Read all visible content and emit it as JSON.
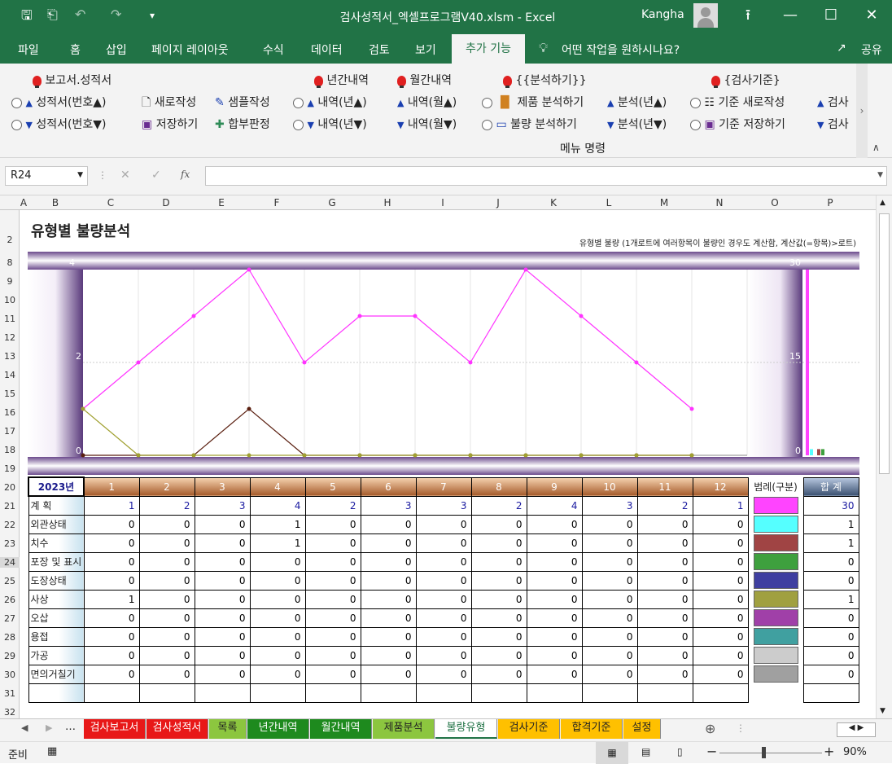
{
  "window": {
    "title": "검사성적서_엑셀프로그램V40.xlsm  -  Excel",
    "user": "Kangha"
  },
  "ribbon_tabs": [
    "파일",
    "홈",
    "삽입",
    "페이지 레이아웃",
    "수식",
    "데이터",
    "검토",
    "보기",
    "추가 기능"
  ],
  "active_tab": "추가 기능",
  "tell_me": "어떤 작업을 원하시나요?",
  "share": "공유",
  "ribbon": {
    "g1_title": "보고서.성적서",
    "g1a": "성적서(번호▲)",
    "g1b": "성적서(번호▼)",
    "g1c": "새로작성",
    "g1d": "저장하기",
    "g1e": "샘플작성",
    "g1f": "합부판정",
    "g2_title": "년간내역",
    "g2a": "내역(년▲)",
    "g2b": "내역(년▼)",
    "g3_title": "월간내역",
    "g3a": "내역(월▲)",
    "g3b": "내역(월▼)",
    "g4_title": "{{분석하기}}",
    "g4a": "제품 분석하기",
    "g4b": "불량 분석하기",
    "g4c": "분석(년▲)",
    "g4d": "분석(년▼)",
    "g5_title": "{검사기준}",
    "g5a": "기준 새로작성",
    "g5b": "기준 저장하기",
    "g5c": "검사",
    "g5d": "검사",
    "group_label": "메뉴 명령"
  },
  "namebox": "R24",
  "columns": [
    "A",
    "B",
    "C",
    "D",
    "E",
    "F",
    "G",
    "H",
    "I",
    "J",
    "K",
    "L",
    "M",
    "N",
    "O",
    "P"
  ],
  "rows": [
    "2",
    "8",
    "9",
    "10",
    "11",
    "12",
    "13",
    "14",
    "15",
    "16",
    "17",
    "18",
    "19",
    "20",
    "21",
    "22",
    "23",
    "24",
    "25",
    "26",
    "27",
    "28",
    "29",
    "30",
    "31",
    "32"
  ],
  "sheet": {
    "title": "유형별 불량분석",
    "note": "유형별 불량 (1개로트에 여러항목이 불량인 경우도 계산함, 계산값(=항목)>로트)",
    "year": "2023년",
    "legend_header": "범례(구분)",
    "total_header": "합 계"
  },
  "chart_data": {
    "type": "line",
    "x": [
      1,
      2,
      3,
      4,
      5,
      6,
      7,
      8,
      9,
      10,
      11,
      12
    ],
    "left_axis": {
      "ticks": [
        "4",
        "2",
        "0"
      ],
      "ylim": [
        0,
        4
      ]
    },
    "right_axis": {
      "ticks": [
        "30",
        "15",
        "0"
      ],
      "ylim": [
        0,
        30
      ]
    },
    "series": [
      {
        "name": "계 획",
        "color": "#ff33ff",
        "values": [
          1,
          2,
          3,
          4,
          2,
          3,
          3,
          2,
          4,
          3,
          2,
          1
        ]
      },
      {
        "name": "외관상태",
        "color": "#5a1f10",
        "values": [
          0,
          0,
          0,
          1,
          0,
          0,
          0,
          0,
          0,
          0,
          0,
          0
        ]
      },
      {
        "name": "치수",
        "color": "#a0a030",
        "values": [
          1,
          0,
          0,
          0,
          0,
          0,
          0,
          0,
          0,
          0,
          0,
          0
        ]
      }
    ],
    "totals_bar": [
      30,
      1,
      1,
      1
    ]
  },
  "table": {
    "months": [
      "1",
      "2",
      "3",
      "4",
      "5",
      "6",
      "7",
      "8",
      "9",
      "10",
      "11",
      "12"
    ],
    "rows": [
      {
        "label": "계 획",
        "values": [
          "1",
          "2",
          "3",
          "4",
          "2",
          "3",
          "3",
          "2",
          "4",
          "3",
          "2",
          "1"
        ],
        "total": "30",
        "color": "#ff44ff"
      },
      {
        "label": "외관상태",
        "values": [
          "0",
          "0",
          "0",
          "1",
          "0",
          "0",
          "0",
          "0",
          "0",
          "0",
          "0",
          "0"
        ],
        "total": "1",
        "color": "#55ffff"
      },
      {
        "label": "치수",
        "values": [
          "0",
          "0",
          "0",
          "1",
          "0",
          "0",
          "0",
          "0",
          "0",
          "0",
          "0",
          "0"
        ],
        "total": "1",
        "color": "#a04444"
      },
      {
        "label": "포장 및 표시",
        "values": [
          "0",
          "0",
          "0",
          "0",
          "0",
          "0",
          "0",
          "0",
          "0",
          "0",
          "0",
          "0"
        ],
        "total": "0",
        "color": "#3ea03e"
      },
      {
        "label": "도장상태",
        "values": [
          "0",
          "0",
          "0",
          "0",
          "0",
          "0",
          "0",
          "0",
          "0",
          "0",
          "0",
          "0"
        ],
        "total": "0",
        "color": "#3f3fa0"
      },
      {
        "label": "사상",
        "values": [
          "1",
          "0",
          "0",
          "0",
          "0",
          "0",
          "0",
          "0",
          "0",
          "0",
          "0",
          "0"
        ],
        "total": "1",
        "color": "#a0a040"
      },
      {
        "label": "오삽",
        "values": [
          "0",
          "0",
          "0",
          "0",
          "0",
          "0",
          "0",
          "0",
          "0",
          "0",
          "0",
          "0"
        ],
        "total": "0",
        "color": "#a040a8"
      },
      {
        "label": "용접",
        "values": [
          "0",
          "0",
          "0",
          "0",
          "0",
          "0",
          "0",
          "0",
          "0",
          "0",
          "0",
          "0"
        ],
        "total": "0",
        "color": "#40a0a0"
      },
      {
        "label": "가공",
        "values": [
          "0",
          "0",
          "0",
          "0",
          "0",
          "0",
          "0",
          "0",
          "0",
          "0",
          "0",
          "0"
        ],
        "total": "0",
        "color": "#cccccc"
      },
      {
        "label": "면의거칠기",
        "values": [
          "0",
          "0",
          "0",
          "0",
          "0",
          "0",
          "0",
          "0",
          "0",
          "0",
          "0",
          "0"
        ],
        "total": "0",
        "color": "#a0a0a0"
      }
    ]
  },
  "sheet_tabs": [
    {
      "label": "검사보고서",
      "color": "#e81818"
    },
    {
      "label": "검사성적서",
      "color": "#e81818"
    },
    {
      "label": "목록",
      "color": "#8cc63f"
    },
    {
      "label": "년간내역",
      "color": "#1e8a1e"
    },
    {
      "label": "월간내역",
      "color": "#1e8a1e"
    },
    {
      "label": "제품분석",
      "color": "#8cc63f"
    },
    {
      "label": "불량유형",
      "color": "#ffffff"
    },
    {
      "label": "검사기준",
      "color": "#ffc000"
    },
    {
      "label": "합격기준",
      "color": "#ffc000"
    },
    {
      "label": "설정",
      "color": "#ffc000"
    }
  ],
  "status": {
    "ready": "준비",
    "zoom": "90%"
  }
}
